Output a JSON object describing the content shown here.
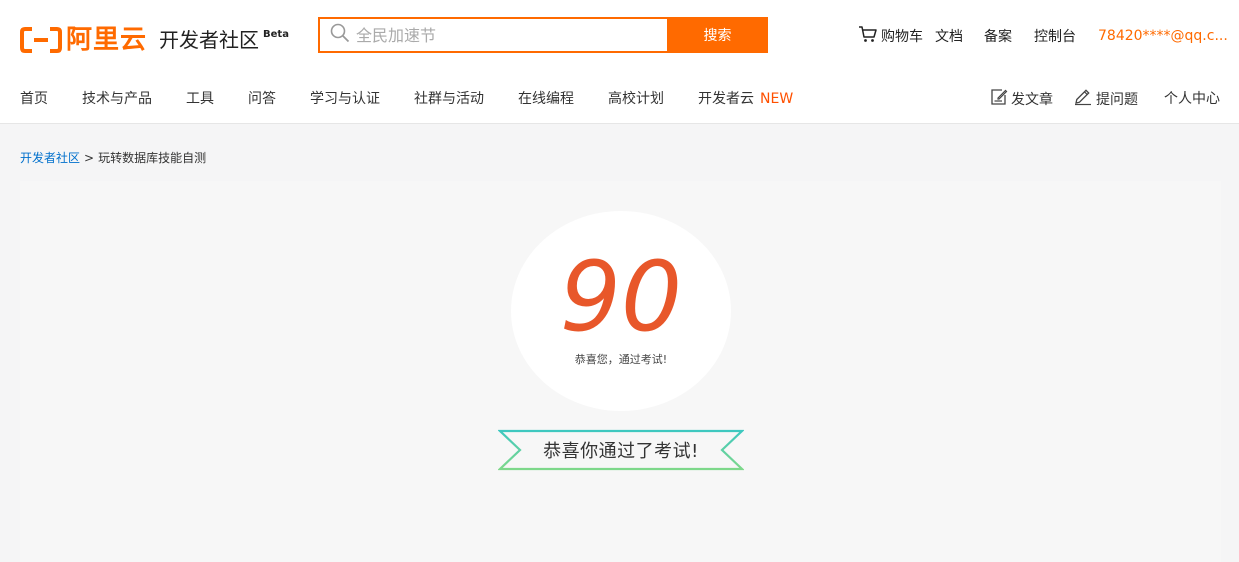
{
  "brand": {
    "logo_text": "阿里云",
    "site_name": "开发者社区",
    "badge": "Beta",
    "accent_color": "#ff6a00"
  },
  "search": {
    "placeholder": "全民加速节",
    "button_label": "搜索"
  },
  "top_links": {
    "cart": "购物车",
    "docs": "文档",
    "filing": "备案",
    "console": "控制台",
    "user": "78420****@qq.c..."
  },
  "nav": {
    "items": [
      {
        "label": "首页"
      },
      {
        "label": "技术与产品"
      },
      {
        "label": "工具"
      },
      {
        "label": "问答"
      },
      {
        "label": "学习与认证"
      },
      {
        "label": "社群与活动"
      },
      {
        "label": "在线编程"
      },
      {
        "label": "高校计划"
      },
      {
        "label": "开发者云",
        "badge": "NEW"
      }
    ],
    "right": {
      "write_article": "发文章",
      "ask_question": "提问题",
      "personal_center": "个人中心"
    }
  },
  "breadcrumb": {
    "root": "开发者社区",
    "separator": ">",
    "current": "玩转数据库技能自测"
  },
  "result": {
    "score": "90",
    "message": "恭喜您，通过考试!",
    "ribbon_text": "恭喜你通过了考试!",
    "score_color": "#e8572a",
    "ribbon_border_colors": [
      "#3ec8c0",
      "#7ed88a"
    ]
  }
}
